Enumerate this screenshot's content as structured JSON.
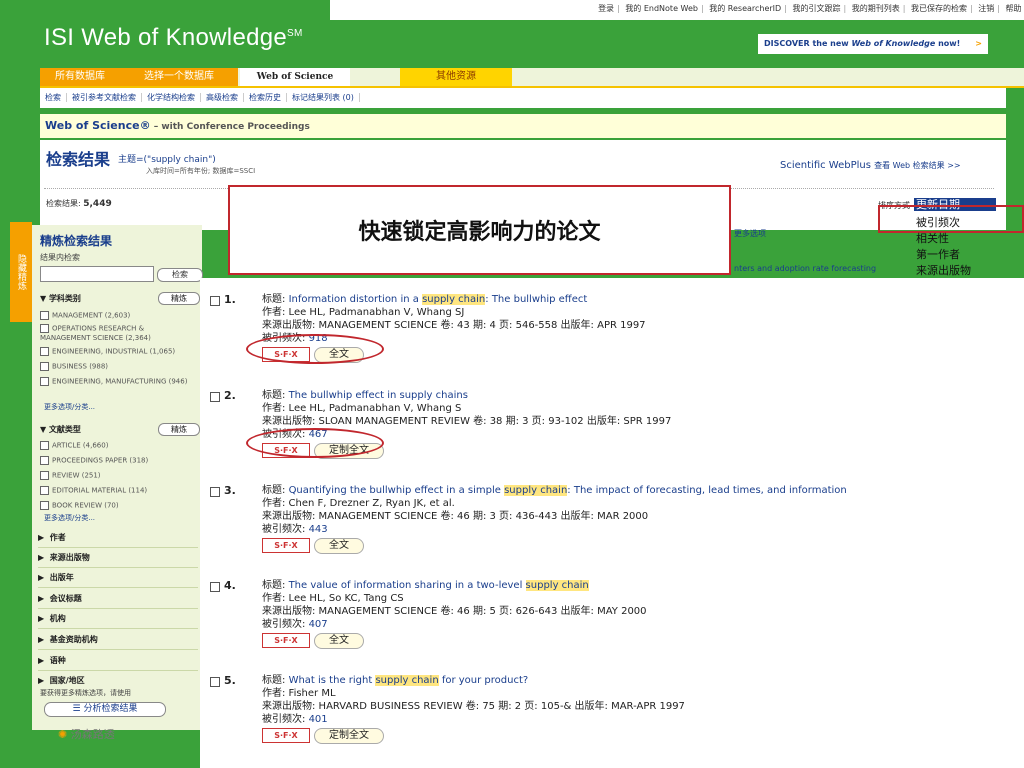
{
  "top_links": [
    "登录",
    "我的 EndNote Web",
    "我的 ResearcherID",
    "我的引文跟踪",
    "我的期刊列表",
    "我已保存的检索",
    "注销",
    "帮助"
  ],
  "logo": {
    "text": "ISI Web of Knowledge",
    "mark": "SM"
  },
  "discover": {
    "prefix": "DISCOVER the new ",
    "brand": "Web of Knowledge",
    "suffix": " now!",
    "arrow": ">"
  },
  "tabs": [
    {
      "label": "所有数据库"
    },
    {
      "label": "选择一个数据库"
    },
    {
      "label": "Web of Science"
    },
    {
      "label": "其他资源"
    }
  ],
  "subnav": [
    "检索",
    "被引参考文献检索",
    "化学结构检索",
    "高级检索",
    "检索历史",
    "标记结果列表 (0)"
  ],
  "wos": {
    "title": "Web of Science®",
    "subtitle": " – with Conference Proceedings"
  },
  "results": {
    "title": "检索结果",
    "query": "主题=(\"supply chain\")",
    "meta": "入库时间=所有年份; 数据库=SSCI",
    "webplus": "Scientific WebPlus",
    "webplus_link": "查看 Web 检索结果 >>",
    "count_label": "检索结果:",
    "count": "5,449",
    "more_options": "更多选项",
    "adoption": "nters and adoption rate forecasting"
  },
  "callout": "快速锁定高影响力的论文",
  "sort": {
    "label": "排序方式",
    "selected": "更新日期",
    "options": [
      "被引频次",
      "相关性",
      "第一作者",
      "来源出版物"
    ]
  },
  "side_tab": "隐藏精炼",
  "sidebar": {
    "title": "精炼检索结果",
    "search_within": "结果内检索",
    "search_btn": "检索",
    "cat_head": "学科类别",
    "refine": "精炼",
    "categories": [
      "MANAGEMENT (2,603)",
      "OPERATIONS RESEARCH & MANAGEMENT SCIENCE (2,364)",
      "ENGINEERING, INDUSTRIAL (1,065)",
      "BUSINESS (988)",
      "ENGINEERING, MANUFACTURING (946)"
    ],
    "more1": "更多选项/分类...",
    "doc_head": "文献类型",
    "doctypes": [
      "ARTICLE (4,660)",
      "PROCEEDINGS PAPER (318)",
      "REVIEW (251)",
      "EDITORIAL MATERIAL (114)",
      "BOOK REVIEW (70)"
    ],
    "more2": "更多选项/分类...",
    "facets": [
      "作者",
      "来源出版物",
      "出版年",
      "会议标题",
      "机构",
      "基金资助机构",
      "语种",
      "国家/地区"
    ],
    "footnote": "要获得更多精炼选项，请使用",
    "analyze": "分析检索结果"
  },
  "brand_bottom": "汤森路透",
  "records": [
    {
      "num": "1.",
      "title_pre": "Information distortion in a ",
      "title_hl": "supply chain",
      "title_post": ": The bullwhip effect",
      "authors": "作者: Lee HL, Padmanabhan V, Whang SJ",
      "source": "来源出版物: MANAGEMENT SCIENCE  卷: 43  期: 4  页: 546-558  出版年: APR 1997",
      "cites": "918",
      "btn": "全文"
    },
    {
      "num": "2.",
      "title_pre": "The bullwhip effect in supply chains",
      "title_hl": "",
      "title_post": "",
      "authors": "作者: Lee HL, Padmanabhan V, Whang S",
      "source": "来源出版物: SLOAN MANAGEMENT REVIEW  卷: 38  期: 3  页: 93-102  出版年: SPR 1997",
      "cites": "467",
      "btn": "定制全文"
    },
    {
      "num": "3.",
      "title_pre": "Quantifying the bullwhip effect in a simple ",
      "title_hl": "supply chain",
      "title_post": ": The impact of forecasting, lead times, and information",
      "authors": "作者: Chen F, Drezner Z, Ryan JK, et al.",
      "source": "来源出版物: MANAGEMENT SCIENCE  卷: 46  期: 3  页: 436-443  出版年: MAR 2000",
      "cites": "443",
      "btn": "全文"
    },
    {
      "num": "4.",
      "title_pre": "The value of information sharing in a two-level ",
      "title_hl": "supply chain",
      "title_post": "",
      "authors": "作者: Lee HL, So KC, Tang CS",
      "source": "来源出版物: MANAGEMENT SCIENCE  卷: 46  期: 5  页: 626-643  出版年: MAY 2000",
      "cites": "407",
      "btn": "全文"
    },
    {
      "num": "5.",
      "title_pre": "What is the right ",
      "title_hl": "supply chain",
      "title_post": " for your product?",
      "authors": "作者: Fisher ML",
      "source": "来源出版物: HARVARD BUSINESS REVIEW  卷: 75  期: 2  页: 105-&  出版年: MAR-APR 1997",
      "cites": "401",
      "btn": "定制全文"
    }
  ],
  "labels": {
    "title": "标题: ",
    "cited": "被引频次: ",
    "sfx": "S·F·X"
  },
  "colors": {
    "green": "#3aa23a",
    "orange": "#f5a000",
    "yellow": "#ffd400",
    "link": "#1a3e8c",
    "highlight_red": "#c1272d"
  }
}
